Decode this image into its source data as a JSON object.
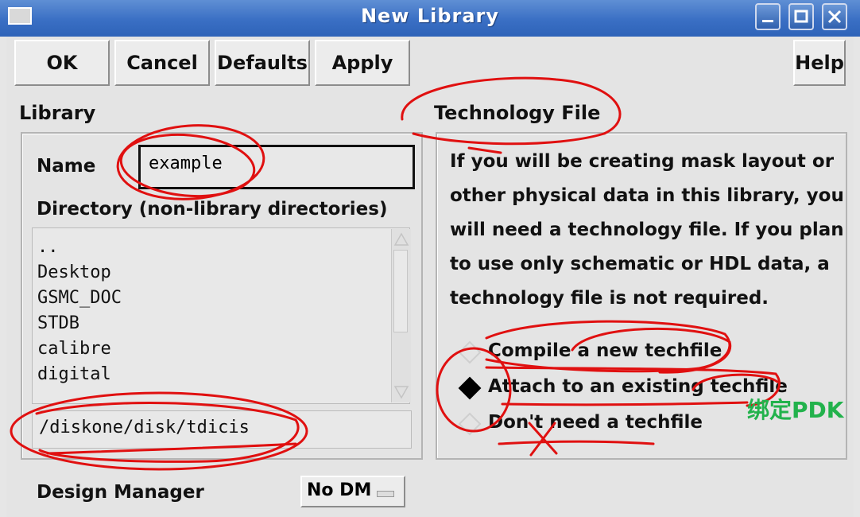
{
  "window": {
    "title": "New Library"
  },
  "toolbar": {
    "ok": "OK",
    "cancel": "Cancel",
    "defaults": "Defaults",
    "apply": "Apply",
    "help": "Help"
  },
  "library": {
    "section_label": "Library",
    "name_label": "Name",
    "name_value": "example",
    "directory_label": "Directory (non-library directories)",
    "directories": [
      "..",
      "Desktop",
      "GSMC_DOC",
      "STDB",
      "calibre",
      "digital"
    ],
    "path_value": "/diskone/disk/tdicis"
  },
  "technology": {
    "section_label": "Technology File",
    "description": "If you will be creating mask layout or other physical data in this library, you will need a technology file. If you plan to use only schematic or HDL data, a technology file is not required.",
    "options": [
      {
        "label": "Compile a new techfile",
        "selected": false
      },
      {
        "label": "Attach to an existing techfile",
        "selected": true
      },
      {
        "label": "Don't need a techfile",
        "selected": false
      }
    ]
  },
  "design_manager": {
    "label": "Design Manager",
    "value": "No DM"
  },
  "annotation": {
    "text": "绑定PDK",
    "color": "#22b24c",
    "ink_color": "#e01010"
  }
}
